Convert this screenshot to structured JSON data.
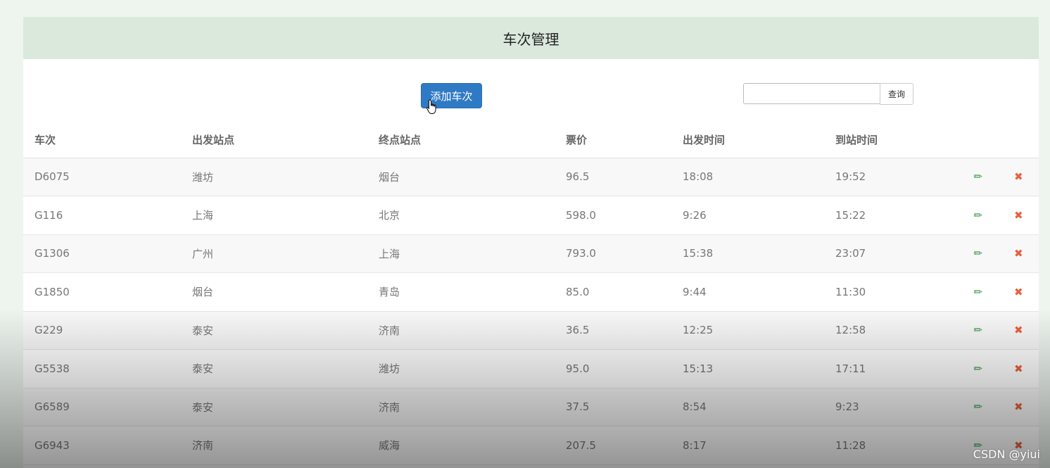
{
  "header": {
    "title": "车次管理"
  },
  "toolbar": {
    "add_label": "添加车次",
    "search_value": "",
    "search_label": "查询"
  },
  "table": {
    "columns": [
      "车次",
      "出发站点",
      "终点站点",
      "票价",
      "出发时间",
      "到站时间"
    ],
    "rows": [
      [
        "D6075",
        "潍坊",
        "烟台",
        "96.5",
        "18:08",
        "19:52"
      ],
      [
        "G116",
        "上海",
        "北京",
        "598.0",
        "9:26",
        "15:22"
      ],
      [
        "G1306",
        "广州",
        "上海",
        "793.0",
        "15:38",
        "23:07"
      ],
      [
        "G1850",
        "烟台",
        "青岛",
        "85.0",
        "9:44",
        "11:30"
      ],
      [
        "G229",
        "泰安",
        "济南",
        "36.5",
        "12:25",
        "12:58"
      ],
      [
        "G5538",
        "泰安",
        "潍坊",
        "95.0",
        "15:13",
        "17:11"
      ],
      [
        "G6589",
        "泰安",
        "济南",
        "37.5",
        "8:54",
        "9:23"
      ],
      [
        "G6943",
        "济南",
        "威海",
        "207.5",
        "8:17",
        "11:28"
      ]
    ],
    "edit_icon": "pencil-icon",
    "delete_icon": "close-icon"
  },
  "watermark": "CSDN @yiui",
  "colors": {
    "header_bg": "#dbe9dd",
    "primary_button": "#2f7ac4",
    "edit_icon": "#3a9a4a",
    "delete_icon": "#e8603e"
  }
}
